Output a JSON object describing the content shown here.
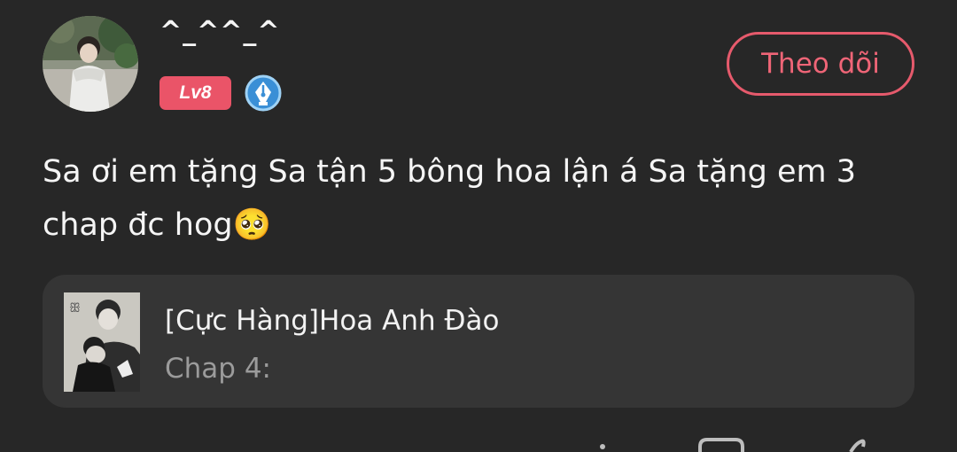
{
  "post": {
    "author": {
      "username": "^_^^_^",
      "level": "Lv8",
      "avatar_icon": "user-avatar",
      "badge_icon": "pen-nib-icon"
    },
    "follow_label": "Theo dõi",
    "comment": "Sa ơi em tặng Sa tận 5 bông hoa lận á Sa tặng em 3 chap đc hog🥺",
    "story": {
      "title": "[Cực Hàng]Hoa Anh Đào",
      "chapter": "Chap 4:"
    }
  },
  "colors": {
    "background": "#272727",
    "card": "#353535",
    "accent": "#e65a6c",
    "level_badge": "#ea5468",
    "secondary_text": "#9b9b9b"
  }
}
